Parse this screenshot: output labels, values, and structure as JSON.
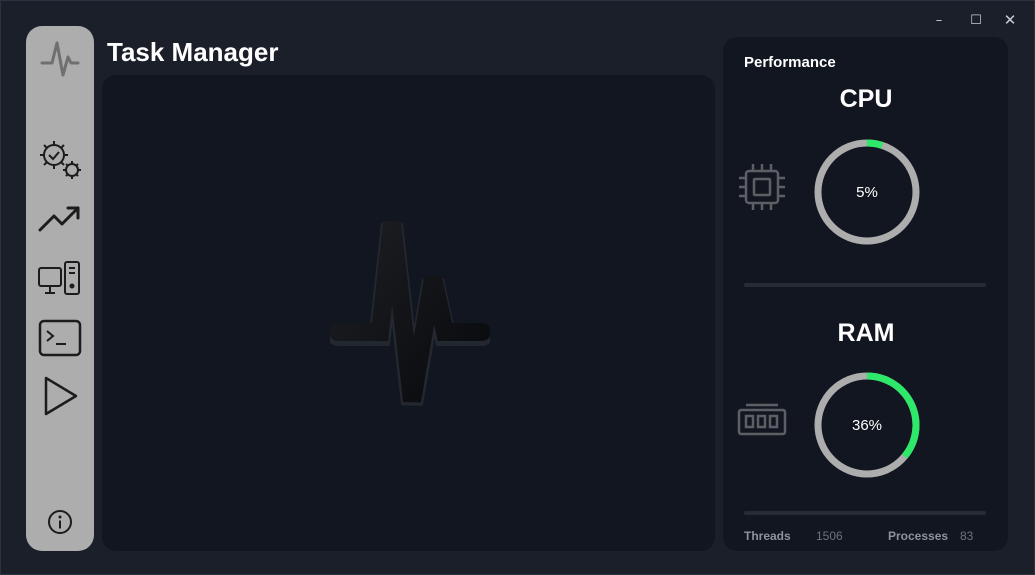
{
  "window": {
    "minimize_glyph": "–",
    "maximize_glyph": "☐",
    "close_glyph": "✕"
  },
  "app": {
    "title": "Task Manager"
  },
  "sidebar": {
    "items": [
      {
        "name": "logo",
        "icon": "pulse-logo-icon"
      },
      {
        "name": "services",
        "icon": "gears-icon"
      },
      {
        "name": "performance",
        "icon": "trend-up-icon"
      },
      {
        "name": "system",
        "icon": "desktop-computer-icon"
      },
      {
        "name": "terminal",
        "icon": "terminal-icon"
      },
      {
        "name": "run",
        "icon": "play-icon"
      },
      {
        "name": "about",
        "icon": "info-icon"
      }
    ]
  },
  "performance": {
    "title": "Performance",
    "cpu": {
      "label": "CPU",
      "percent_text": "5%",
      "percent": 5
    },
    "ram": {
      "label": "RAM",
      "percent_text": "36%",
      "percent": 36
    },
    "threads": {
      "label": "Threads",
      "value": "1506"
    },
    "processes": {
      "label": "Processes",
      "value": "83"
    }
  },
  "colors": {
    "background": "#1b1f2a",
    "panel": "#111620",
    "sidebar": "#adadad",
    "gauge_track": "#adadad",
    "gauge_fill": "#2ee86a"
  }
}
